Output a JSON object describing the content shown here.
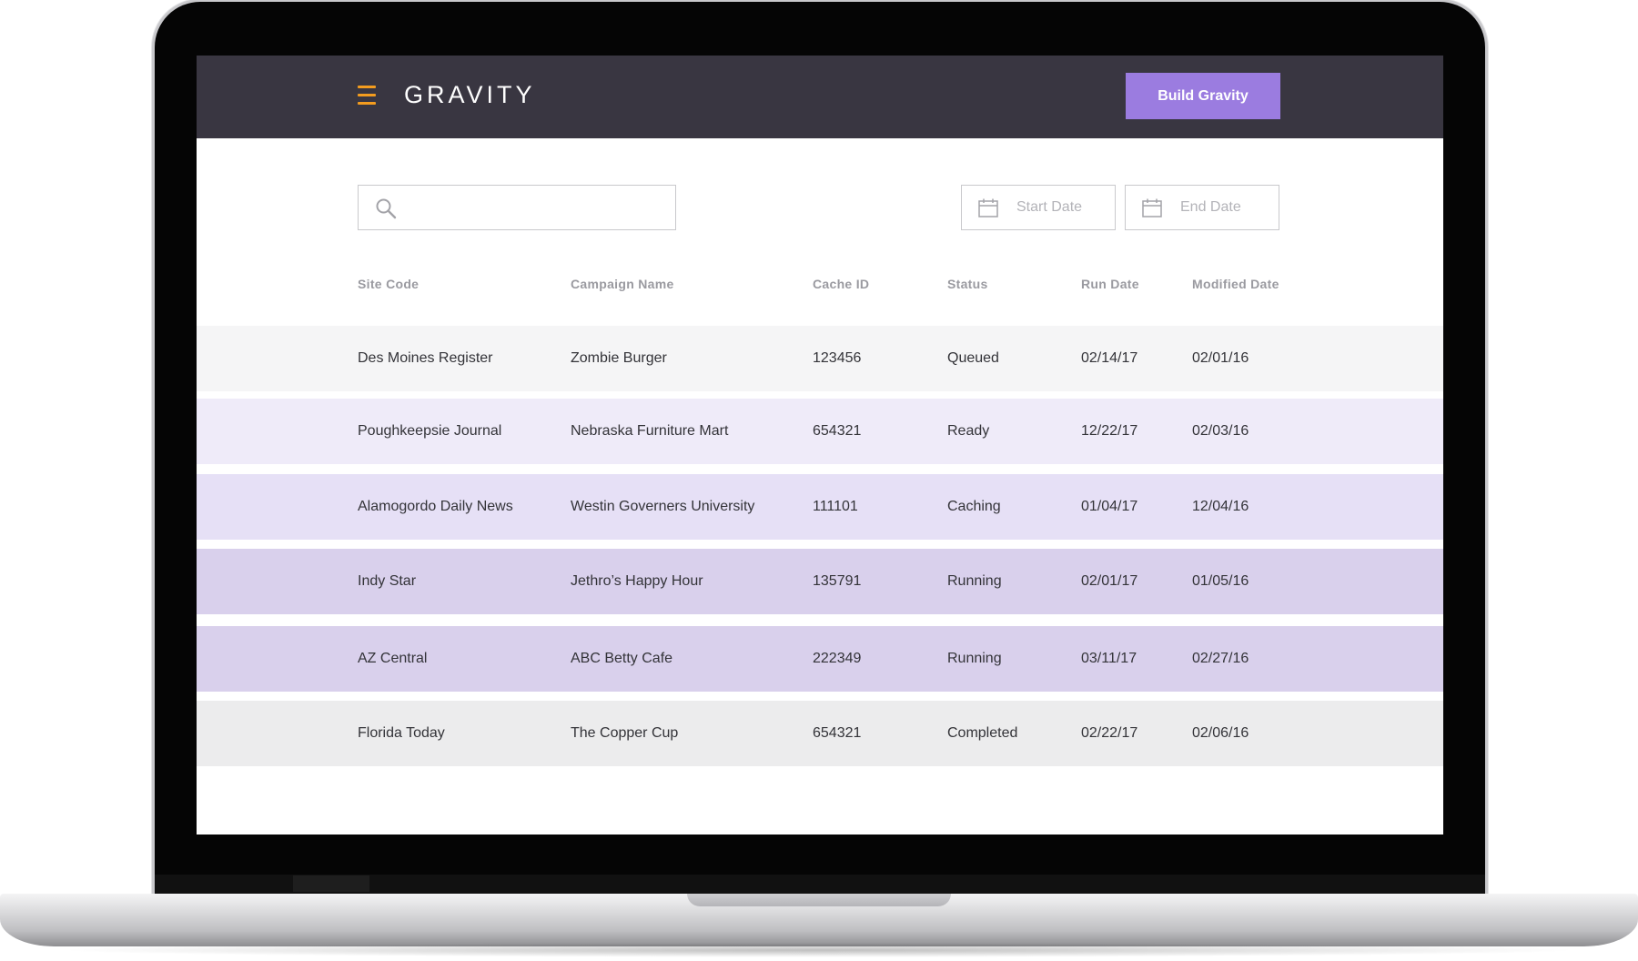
{
  "app": {
    "title": "GRAVITY",
    "build_button": "Build Gravity"
  },
  "filters": {
    "search_value": "",
    "start_date_placeholder": "Start Date",
    "end_date_placeholder": "End Date"
  },
  "table": {
    "columns": [
      "Site Code",
      "Campaign Name",
      "Cache ID",
      "Status",
      "Run Date",
      "Modified Date"
    ],
    "rows": [
      {
        "site": "Des Moines Register",
        "campaign": "Zombie Burger",
        "cache_id": "123456",
        "status": "Queued",
        "run_date": "02/14/17",
        "modified": "02/01/16",
        "color": "#f5f5f6"
      },
      {
        "site": "Poughkeepsie Journal",
        "campaign": "Nebraska Furniture Mart",
        "cache_id": "654321",
        "status": "Ready",
        "run_date": "12/22/17",
        "modified": "02/03/16",
        "color": "#efebf9"
      },
      {
        "site": "Alamogordo Daily News",
        "campaign": "Westin Governers University",
        "cache_id": "111101",
        "status": "Caching",
        "run_date": "01/04/17",
        "modified": "12/04/16",
        "color": "#e6e0f6"
      },
      {
        "site": "Indy Star",
        "campaign": "Jethro’s Happy Hour",
        "cache_id": "135791",
        "status": "Running",
        "run_date": "02/01/17",
        "modified": "01/05/16",
        "color": "#d9d0ec"
      },
      {
        "site": "AZ Central",
        "campaign": "ABC Betty Cafe",
        "cache_id": "222349",
        "status": "Running",
        "run_date": "03/11/17",
        "modified": "02/27/16",
        "color": "#d9d0ec"
      },
      {
        "site": "Florida Today",
        "campaign": "The Copper Cup",
        "cache_id": "654321",
        "status": "Completed",
        "run_date": "02/22/17",
        "modified": "02/06/16",
        "color": "#ececed"
      }
    ]
  },
  "colors": {
    "topbar": "#393641",
    "accent": "#9b7ce0",
    "menu_icon": "#f39c1f"
  }
}
